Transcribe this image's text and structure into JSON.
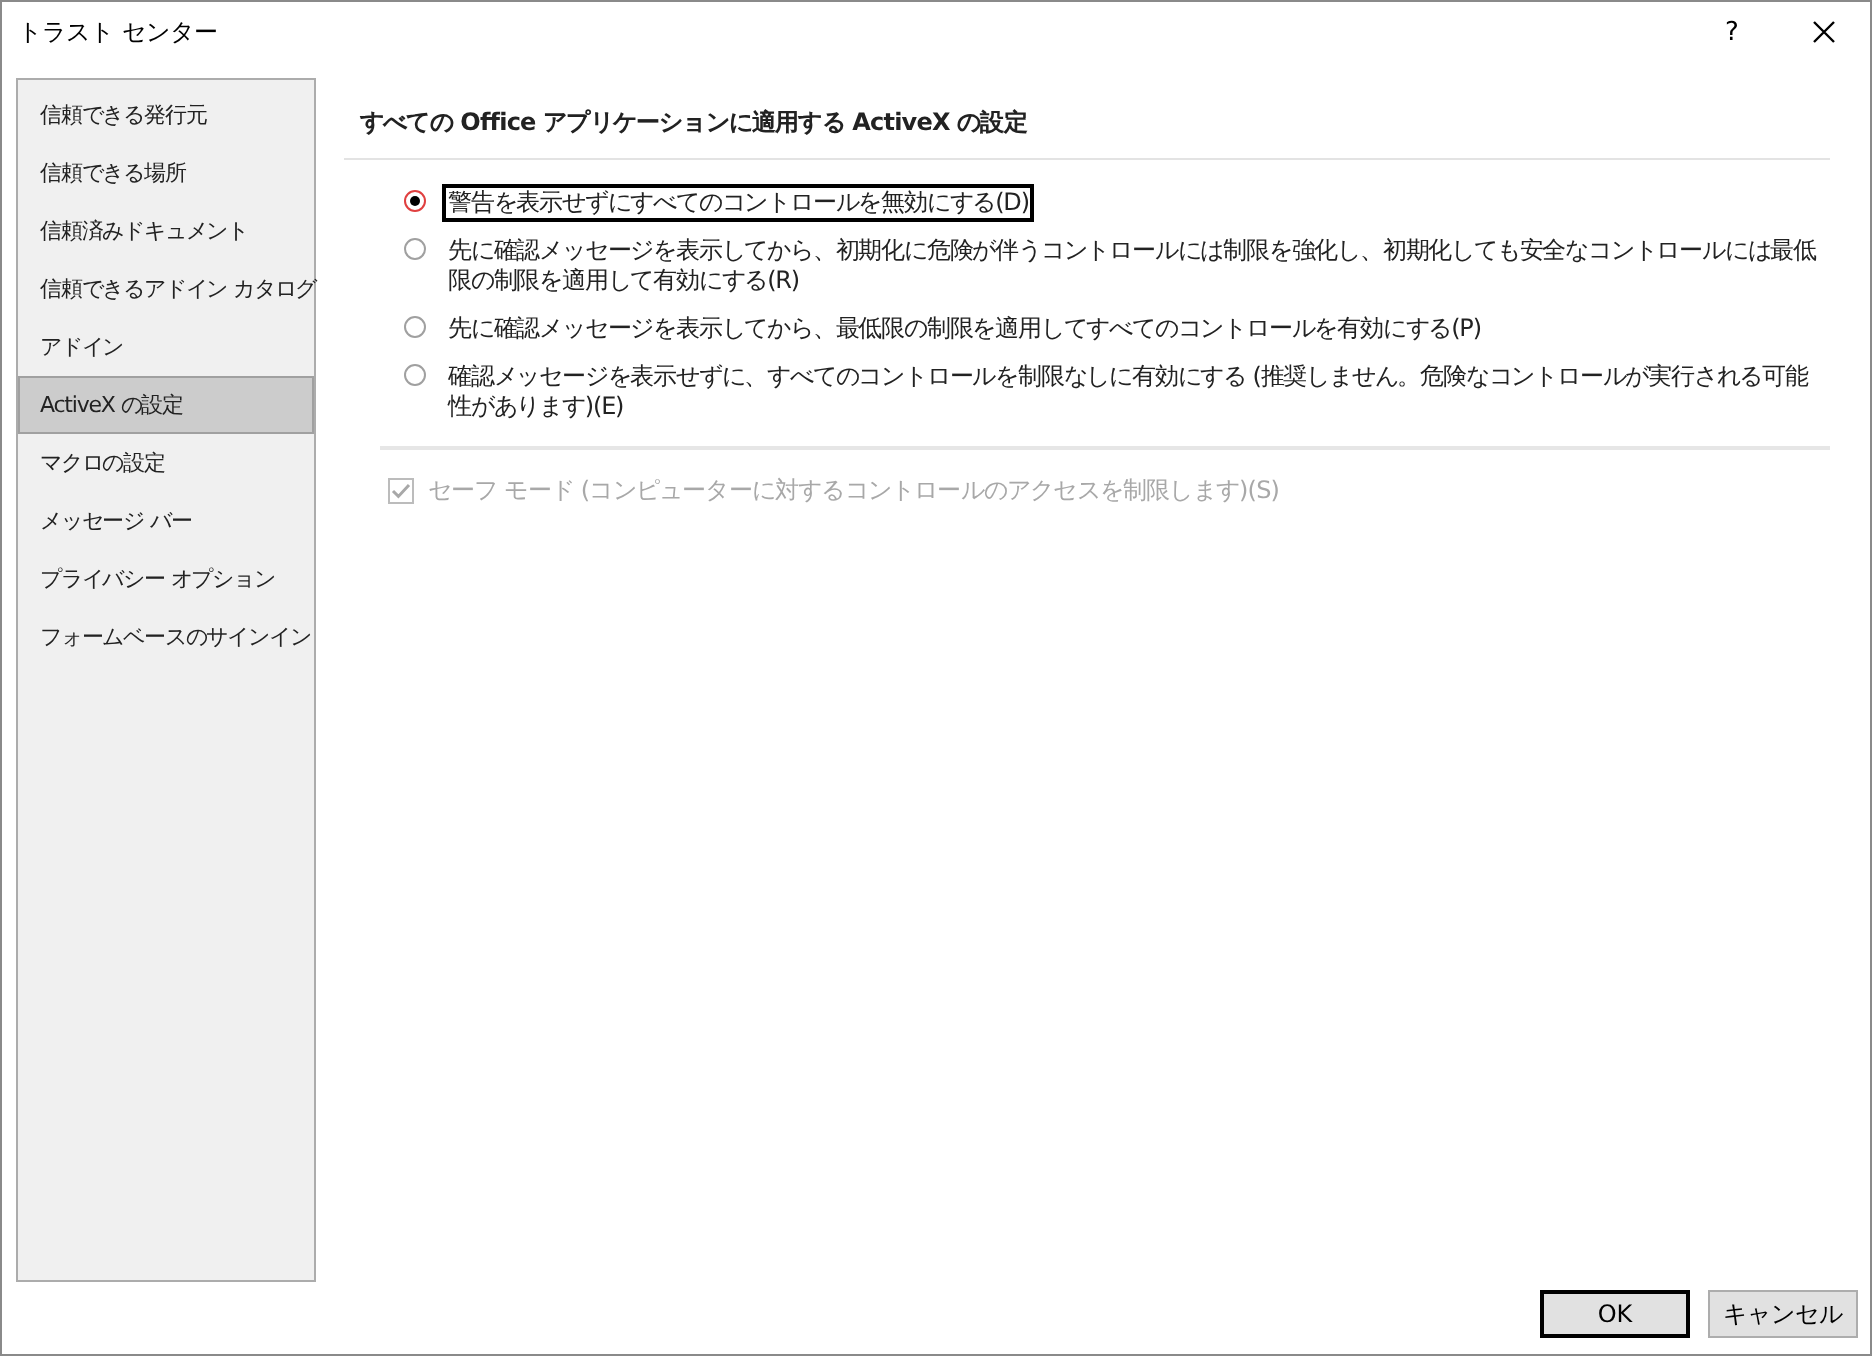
{
  "window": {
    "title": "トラスト センター",
    "help": "?"
  },
  "sidebar": {
    "items": [
      {
        "label": "信頼できる発行元",
        "selected": false
      },
      {
        "label": "信頼できる場所",
        "selected": false
      },
      {
        "label": "信頼済みドキュメント",
        "selected": false
      },
      {
        "label": "信頼できるアドイン カタログ",
        "selected": false
      },
      {
        "label": "アドイン",
        "selected": false
      },
      {
        "label": "ActiveX の設定",
        "selected": true
      },
      {
        "label": "マクロの設定",
        "selected": false
      },
      {
        "label": "メッセージ バー",
        "selected": false
      },
      {
        "label": "プライバシー オプション",
        "selected": false
      },
      {
        "label": "フォームベースのサインイン",
        "selected": false
      }
    ]
  },
  "section": {
    "heading": "すべての Office アプリケーションに適用する ActiveX の設定",
    "options": [
      {
        "label": "警告を表示せずにすべてのコントロールを無効にする(D)",
        "selected": true
      },
      {
        "label": "先に確認メッセージを表示してから、初期化に危険が伴うコントロールには制限を強化し、初期化しても安全なコントロールには最低限の制限を適用して有効にする(R)",
        "selected": false
      },
      {
        "label": "先に確認メッセージを表示してから、最低限の制限を適用してすべてのコントロールを有効にする(P)",
        "selected": false
      },
      {
        "label": "確認メッセージを表示せずに、すべてのコントロールを制限なしに有効にする (推奨しません。危険なコントロールが実行される可能性があります)(E)",
        "selected": false
      }
    ],
    "safe_mode": {
      "label": "セーフ モード (コンピューターに対するコントロールのアクセスを制限します)(S)",
      "checked": true,
      "disabled": true
    }
  },
  "buttons": [
    {
      "label": "OK",
      "default": true
    },
    {
      "label": "キャンセル",
      "default": false
    }
  ]
}
